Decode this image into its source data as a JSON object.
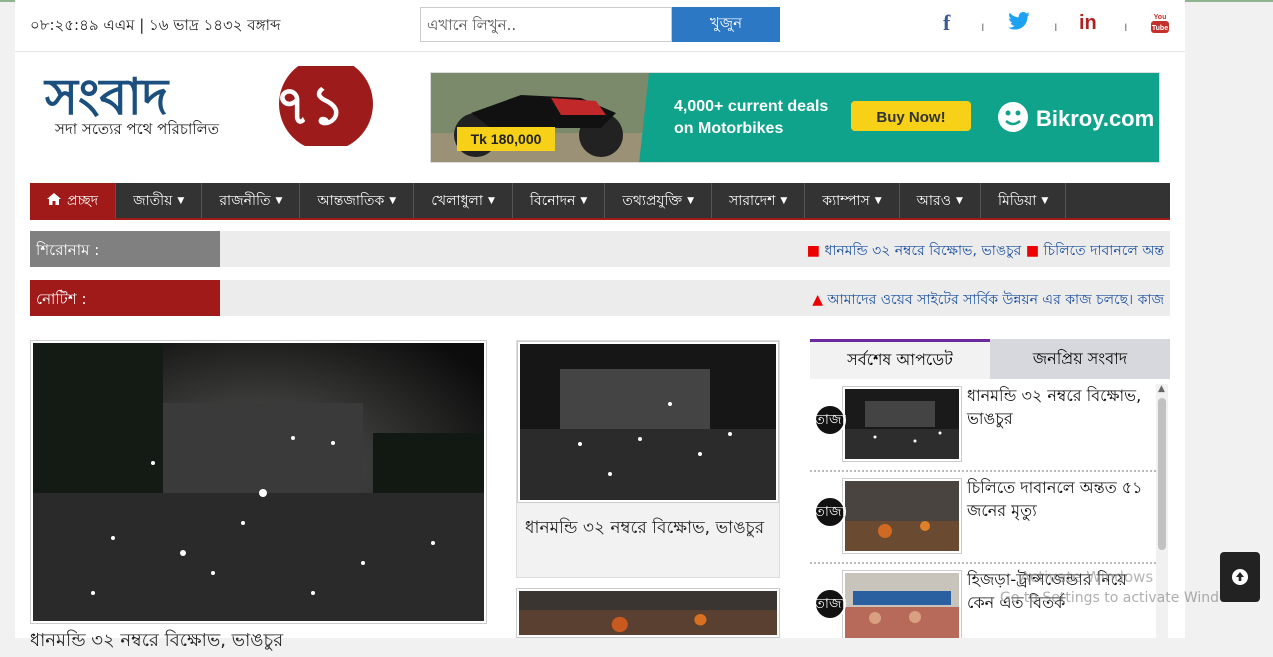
{
  "topbar": {
    "datetime": "০৮:২৫:৪৯ এএম | ১৬ ভাদ্র ১৪৩২ বঙ্গাব্দ",
    "search_placeholder": "এখানে লিখুন..",
    "search_button": "খুজুন",
    "social": [
      "facebook-icon",
      "twitter-icon",
      "linkedin-icon",
      "youtube-icon"
    ],
    "separator": "।"
  },
  "logo": {
    "name": "সংবাদ",
    "number": "৭১",
    "tagline": "সদা সত্যের পথে পরিচালিত"
  },
  "banner": {
    "price": "Tk 180,000",
    "line1": "4,000+ current deals",
    "line2": "on Motorbikes",
    "cta": "Buy Now!",
    "brand": "Bikroy.com"
  },
  "nav": {
    "items": [
      "প্রচ্ছদ",
      "জাতীয়",
      "রাজনীতি",
      "আন্তজাতিক",
      "খেলাধুলা",
      "বিনোদন",
      "তথ্যপ্রযুক্তি",
      "সারাদেশ",
      "ক্যাম্পাস",
      "আরও",
      "মিডিয়া"
    ]
  },
  "headline_ticker": {
    "label": "শিরোনাম :",
    "items": [
      "ধানমন্ডি ৩২ নম্বরে বিক্ষোভ, ভাঙচুর",
      "চিলিতে দাবানলে অন্ত"
    ]
  },
  "notice_ticker": {
    "label": "নোটিশ :",
    "text": "আমাদের ওয়েব সাইটের সার্বিক উন্নয়ন এর কাজ চলছে। কাজ"
  },
  "lead": {
    "caption": "ধানমন্ডি ৩২ নম্বরে বিক্ষোভ, ভাঙচুর"
  },
  "card1": {
    "title": "ধানমন্ডি ৩২ নম্বরে বিক্ষোভ, ভাঙচুর"
  },
  "side": {
    "tab_latest": "সর্বশেষ আপডেট",
    "tab_popular": "জনপ্রিয় সংবাদ",
    "badge": "তাজা",
    "items": [
      "ধানমন্ডি ৩২ নম্বরে বিক্ষোভ, ভাঙচুর",
      "চিলিতে দাবানলে অন্তত ৫১ জনের মৃত্যু",
      "হিজড়া-ট্রান্সজেন্ডার নিয়ে কেন এত বিতর্ক"
    ]
  },
  "overlay": {
    "line1": "Activate Windows",
    "line2": "Go to Settings to activate Windows."
  },
  "colors": {
    "brand_red": "#a01a1a",
    "nav_bg": "#333333",
    "search_blue": "#2d78c4",
    "tab_accent": "#6a2aa0"
  }
}
